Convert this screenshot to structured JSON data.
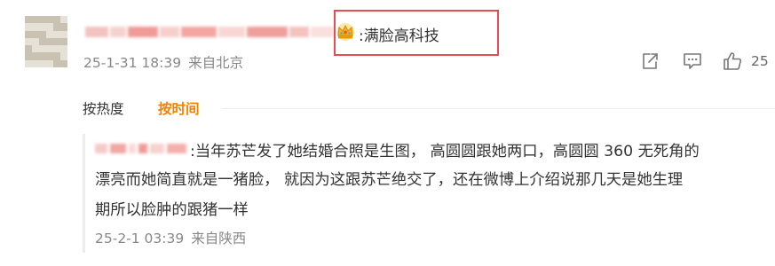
{
  "comment": {
    "reply_text": ":满脸高科技",
    "date": "25-1-31 18:39",
    "location": "来自北京",
    "like_count": "25",
    "icons": [
      "crown-icon",
      "share-icon",
      "comment-icon",
      "like-icon"
    ]
  },
  "sort": {
    "by_hot": "按热度",
    "by_time": "按时间"
  },
  "sub_comment": {
    "line1": ":当年苏芒发了她结婚合照是生图， 高圆圆跟她两口，高圆圆 360 无死角的",
    "line2": "漂亮而她简直就是一猪脸， 就因为这跟苏芒绝交了，还在微博上介绍说那几天是她生理",
    "line3": "期所以脸肿的跟猪一样",
    "date": "25-2-1 03:39",
    "location": "来自陕西"
  },
  "colors": {
    "accent_orange": "#f78000",
    "highlight_red": "#e74c53",
    "meta_gray": "#888888"
  }
}
